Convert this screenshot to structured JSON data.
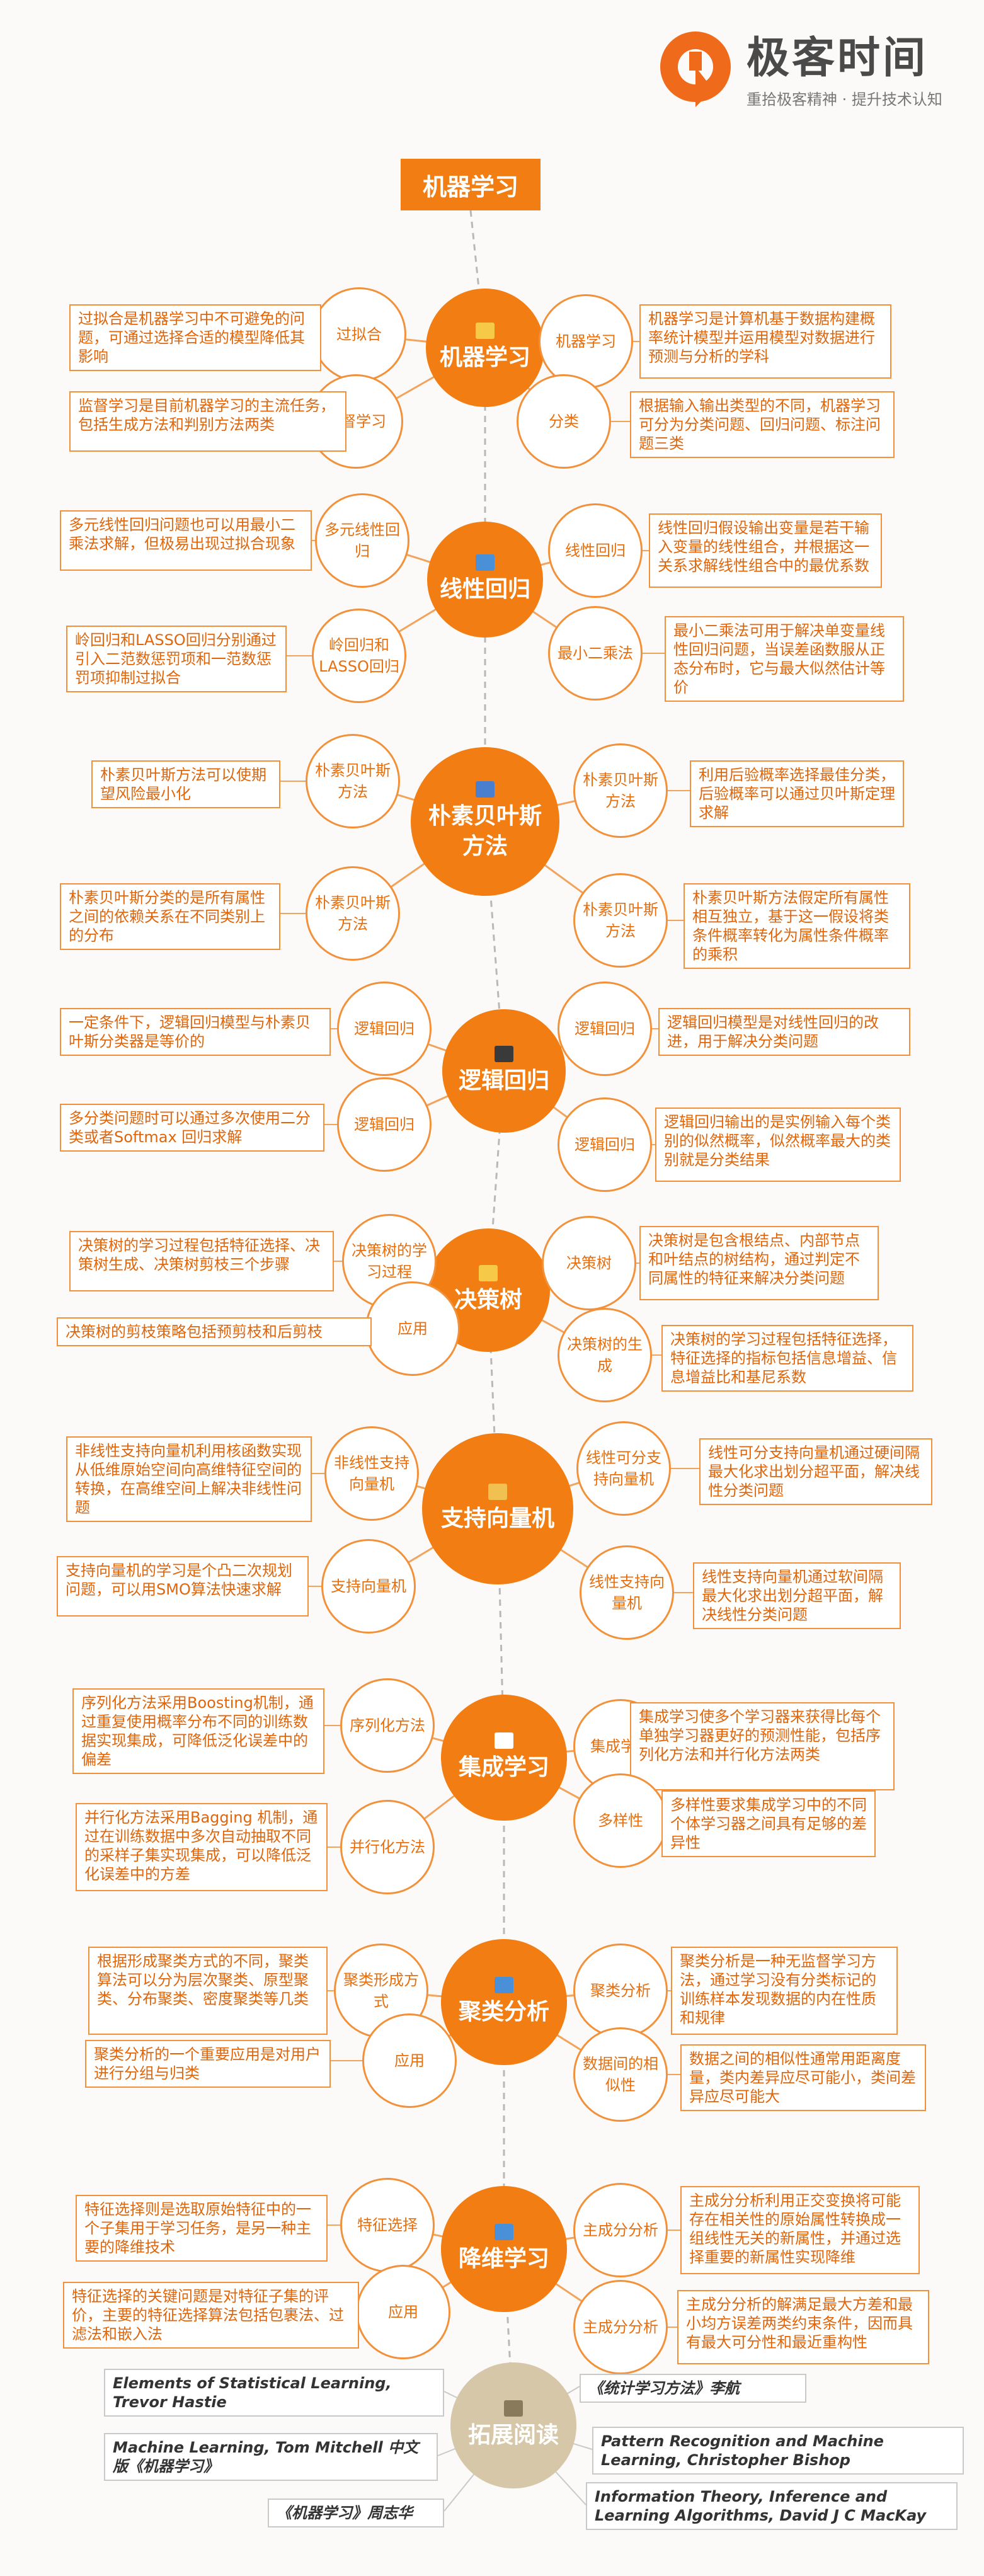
{
  "brand": {
    "name": "极客时间",
    "slogan": "重拾极客精神 · 提升技术认知",
    "color": "#ef6a1a"
  },
  "title": "机器学习",
  "sections": [
    {
      "center": "机器学习",
      "icon_color": "#f7c948",
      "left": [
        {
          "node": "过拟合",
          "text": "过拟合是机器学习中不可避免的问题，可通过选择合适的模型降低其影响"
        },
        {
          "node": "监督学习",
          "text": "监督学习是目前机器学习的主流任务，包括生成方法和判别方法两类"
        }
      ],
      "right": [
        {
          "node": "机器学习",
          "text": "机器学习是计算机基于数据构建概率统计模型并运用模型对数据进行预测与分析的学科"
        },
        {
          "node": "分类",
          "text": "根据输入输出类型的不同，机器学习可分为分类问题、回归问题、标注问题三类"
        }
      ]
    },
    {
      "center": "线性回归",
      "icon_color": "#4a90d9",
      "left": [
        {
          "node": "多元线性回归",
          "text": "多元线性回归问题也可以用最小二乘法求解，但极易出现过拟合现象"
        },
        {
          "node": "岭回归和LASSO回归",
          "text": "岭回归和LASSO回归分别通过引入二范数惩罚项和一范数惩罚项抑制过拟合"
        }
      ],
      "right": [
        {
          "node": "线性回归",
          "text": "线性回归假设输出变量是若干输入变量的线性组合，并根据这一关系求解线性组合中的最优系数"
        },
        {
          "node": "最小二乘法",
          "text": "最小二乘法可用于解决单变量线性回归问题，当误差函数服从正态分布时，它与最大似然估计等价"
        }
      ]
    },
    {
      "center": "朴素贝叶斯方法",
      "icon_color": "#4a7fd0",
      "left": [
        {
          "node": "朴素贝叶斯方法",
          "text": "朴素贝叶斯方法可以使期望风险最小化"
        },
        {
          "node": "朴素贝叶斯方法",
          "text": "朴素贝叶斯分类的是所有属性之间的依赖关系在不同类别上的分布"
        }
      ],
      "right": [
        {
          "node": "朴素贝叶斯方法",
          "text": "利用后验概率选择最佳分类，后验概率可以通过贝叶斯定理求解"
        },
        {
          "node": "朴素贝叶斯方法",
          "text": "朴素贝叶斯方法假定所有属性相互独立，基于这一假设将类条件概率转化为属性条件概率的乘积"
        }
      ]
    },
    {
      "center": "逻辑回归",
      "icon_color": "#3a3a3a",
      "left": [
        {
          "node": "逻辑回归",
          "text": "一定条件下，逻辑回归模型与朴素贝叶斯分类器是等价的"
        },
        {
          "node": "逻辑回归",
          "text": "多分类问题时可以通过多次使用二分类或者Softmax 回归求解"
        }
      ],
      "right": [
        {
          "node": "逻辑回归",
          "text": "逻辑回归模型是对线性回归的改进，用于解决分类问题"
        },
        {
          "node": "逻辑回归",
          "text": "逻辑回归输出的是实例输入每个类别的似然概率，似然概率最大的类别就是分类结果"
        }
      ]
    },
    {
      "center": "决策树",
      "icon_color": "#f7c948",
      "left": [
        {
          "node": "决策树的学习过程",
          "text": "决策树的学习过程包括特征选择、决策树生成、决策树剪枝三个步骤"
        },
        {
          "node": "应用",
          "text": "决策树的剪枝策略包括预剪枝和后剪枝"
        }
      ],
      "right": [
        {
          "node": "决策树",
          "text": "决策树是包含根结点、内部节点和叶结点的树结构，通过判定不同属性的特征来解决分类问题"
        },
        {
          "node": "决策树的生成",
          "text": "决策树的学习过程包括特征选择，特征选择的指标包括信息增益、信息增益比和基尼系数"
        }
      ]
    },
    {
      "center": "支持向量机",
      "icon_color": "#f0c050",
      "left": [
        {
          "node": "非线性支持向量机",
          "text": "非线性支持向量机利用核函数实现从低维原始空间向高维特征空间的转换，在高维空间上解决非线性问题"
        },
        {
          "node": "支持向量机",
          "text": "支持向量机的学习是个凸二次规划问题，可以用SMO算法快速求解"
        }
      ],
      "right": [
        {
          "node": "线性可分支持向量机",
          "text": "线性可分支持向量机通过硬间隔最大化求出划分超平面，解决线性分类问题"
        },
        {
          "node": "线性支持向量机",
          "text": "线性支持向量机通过软间隔最大化求出划分超平面，解决线性分类问题"
        }
      ]
    },
    {
      "center": "集成学习",
      "icon_color": "#ffffff",
      "left": [
        {
          "node": "序列化方法",
          "text": "序列化方法采用Boosting机制，通过重复使用概率分布不同的训练数据实现集成，可降低泛化误差中的偏差"
        },
        {
          "node": "并行化方法",
          "text": "并行化方法采用Bagging 机制，通过在训练数据中多次自动抽取不同的采样子集实现集成，可以降低泛化误差中的方差"
        }
      ],
      "right": [
        {
          "node": "集成学习",
          "text": "集成学习使多个学习器来获得比每个单独学习器更好的预测性能，包括序列化方法和并行化方法两类"
        },
        {
          "node": "多样性",
          "text": "多样性要求集成学习中的不同个体学习器之间具有足够的差异性"
        }
      ]
    },
    {
      "center": "聚类分析",
      "icon_color": "#4a90d9",
      "left": [
        {
          "node": "聚类形成方式",
          "text": "根据形成聚类方式的不同，聚类算法可以分为层次聚类、原型聚类、分布聚类、密度聚类等几类"
        },
        {
          "node": "应用",
          "text": "聚类分析的一个重要应用是对用户进行分组与归类"
        }
      ],
      "right": [
        {
          "node": "聚类分析",
          "text": "聚类分析是一种无监督学习方法，通过学习没有分类标记的训练样本发现数据的内在性质和规律"
        },
        {
          "node": "数据间的相似性",
          "text": "数据之间的相似性通常用距离度量，类内差异应尽可能小，类间差异应尽可能大"
        }
      ]
    },
    {
      "center": "降维学习",
      "icon_color": "#4a90d9",
      "left": [
        {
          "node": "特征选择",
          "text": "特征选择则是选取原始特征中的一个子集用于学习任务，是另一种主要的降维技术"
        },
        {
          "node": "应用",
          "text": "特征选择的关键问题是对特征子集的评价，主要的特征选择算法包括包裹法、过滤法和嵌入法"
        }
      ],
      "right": [
        {
          "node": "主成分分析",
          "text": "主成分分析利用正交变换将可能存在相关性的原始属性转换成一组线性无关的新属性，并通过选择重要的新属性实现降维"
        },
        {
          "node": "主成分分析",
          "text": "主成分分析的解满足最大方差和最小均方误差两类约束条件，因而具有最大可分性和最近重构性"
        }
      ]
    }
  ],
  "reading": {
    "center": "拓展阅读",
    "left": [
      "Elements of Statistical Learning, Trevor Hastie",
      "Machine Learning, Tom Mitchell 中文版《机器学习》",
      "《机器学习》周志华"
    ],
    "right": [
      "《统计学习方法》李航",
      "Pattern Recognition and Machine Learning, Christopher Bishop",
      "Information Theory, Inference and Learning Algorithms, David J C MacKay"
    ]
  }
}
